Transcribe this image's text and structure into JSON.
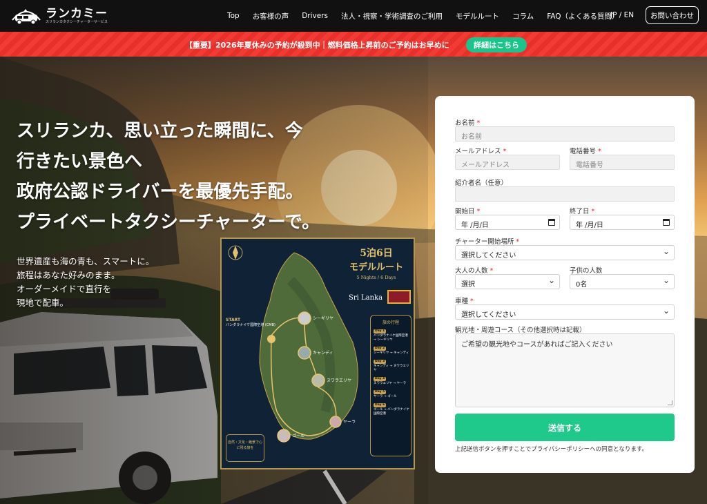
{
  "header": {
    "brand_title": "ランカミー",
    "brand_subtitle": "スリランカタクシーチャーターサービス",
    "nav": [
      "Top",
      "お客様の声",
      "Drivers",
      "法人・視察・学術調査のご利用",
      "モデルルート",
      "コラム",
      "FAQ（よくある質問）"
    ],
    "lang": "JP / EN",
    "contact_label": "お問い合わせ"
  },
  "banner": {
    "text": "【重要】2026年夏休みの予約が殺到中｜燃料価格上昇前のご予約はお早めに",
    "button_label": "詳細はこちら",
    "bg_color": "#f23b35",
    "button_color": "#1bc48a"
  },
  "hero": {
    "headline": [
      "スリランカ、思い立った瞬間に、今",
      "行きたい景色へ",
      "政府公認ドライバーを最優先手配。",
      "プライベートタクシーチャーターで。"
    ],
    "sub": [
      "世界遺産も海の青も、スマートに。",
      "旅程はあなた好みのまま。",
      "オーダーメイドで直行を",
      "現地で配車。"
    ]
  },
  "poster": {
    "title1": "5泊6日",
    "title2": "モデルルート",
    "title3": "5 Nights / 6 Days",
    "country": "Sri Lanka",
    "itinerary_title": "旅の行程",
    "days": [
      {
        "day": "Day 1",
        "text": "バンダラナイケ国際空港 → シーギリヤ"
      },
      {
        "day": "Day 2",
        "text": "シーギリヤ → キャンディ"
      },
      {
        "day": "Day 3",
        "text": "キャンディ → ヌワラエリヤ"
      },
      {
        "day": "Day 4",
        "text": "ヌワラエリヤ → ヤーラ"
      },
      {
        "day": "Day 5",
        "text": "ヤーラ → ゴール"
      },
      {
        "day": "Day 6",
        "text": "ゴール → バンダラナイケ国際空港"
      }
    ],
    "start_title": "START",
    "start_text": "バンダラナイケ国際空港 (CMB)",
    "note": "自然・文化・絶景で心に残る旅を",
    "places": [
      "シーギリヤ",
      "キャンディ",
      "ヌワラエリヤ",
      "ヤーラ",
      "ゴール"
    ]
  },
  "form": {
    "name_label": "お名前",
    "name_placeholder": "お名前",
    "email_label": "メールアドレス",
    "email_placeholder": "メールアドレス",
    "phone_label": "電話番号",
    "phone_placeholder": "電話番号",
    "referrer_label": "紹介者名（任意）",
    "start_date_label": "開始日",
    "start_date_value": "年 /月/日",
    "end_date_label": "終了日",
    "end_date_value": "年 /月/日",
    "pickup_label": "チャーター開始場所",
    "pickup_value": "選択してください",
    "adults_label": "大人の人数",
    "adults_value": "選択",
    "children_label": "子供の人数",
    "children_value": "0名",
    "vehicle_label": "車種",
    "vehicle_value": "選択してください",
    "course_label": "観光地・周遊コース（その他選択時は記載）",
    "course_placeholder": "ご希望の観光地やコースがあればご記入ください",
    "submit_label": "送信する",
    "note": "上記送信ボタンを押すことでプライバシーポリシーへの同意となります。",
    "required_mark": "*"
  }
}
